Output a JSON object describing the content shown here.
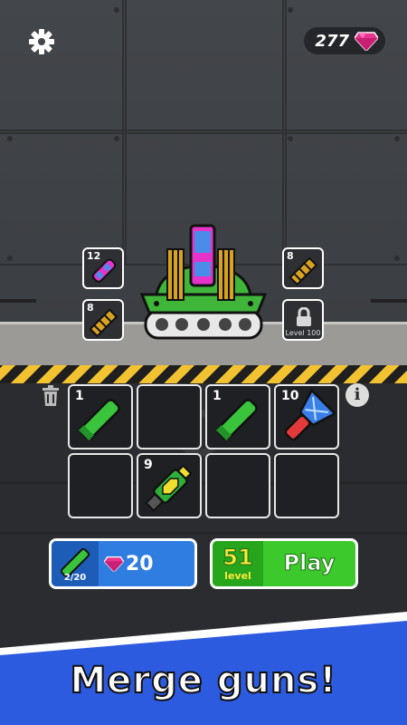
{
  "hud": {
    "gem_count": "277",
    "settings_icon": "gear-icon",
    "gem_icon": "pink-gem-icon"
  },
  "tank_slots": [
    {
      "level": "12",
      "weapon": "pink-cannon-icon",
      "locked": false
    },
    {
      "level": "8",
      "weapon": "gatling-gun-icon",
      "locked": false
    },
    {
      "level": "8",
      "weapon": "gatling-gun-icon",
      "locked": false
    },
    {
      "level": "",
      "weapon": "lock-icon",
      "locked": true,
      "locked_label": "Level 100"
    }
  ],
  "merge_grid": [
    {
      "level": "1",
      "weapon": "green-cannon-icon"
    },
    {
      "level": "",
      "weapon": ""
    },
    {
      "level": "1",
      "weapon": "green-cannon-icon"
    },
    {
      "level": "10",
      "weapon": "blue-red-blaster-icon"
    },
    {
      "level": "",
      "weapon": ""
    },
    {
      "level": "9",
      "weapon": "green-yellow-cannon-icon"
    },
    {
      "level": "",
      "weapon": ""
    },
    {
      "level": "",
      "weapon": ""
    }
  ],
  "buy_button": {
    "count": "2/20",
    "price": "20"
  },
  "play_button": {
    "level_number": "51",
    "level_word": "level",
    "label": "Play"
  },
  "banner": {
    "text": "Merge  guns!"
  },
  "colors": {
    "gem": "#e8338f",
    "tank_green": "#3fb53a",
    "buy_blue": "#2f7de1",
    "play_green": "#3bc92c",
    "banner_blue": "#2d5be0"
  }
}
